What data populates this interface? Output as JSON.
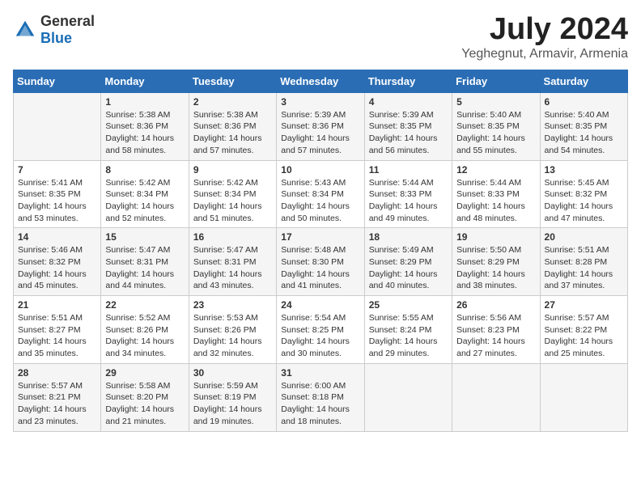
{
  "logo": {
    "general": "General",
    "blue": "Blue"
  },
  "title": {
    "month_year": "July 2024",
    "location": "Yeghegnut, Armavir, Armenia"
  },
  "weekdays": [
    "Sunday",
    "Monday",
    "Tuesday",
    "Wednesday",
    "Thursday",
    "Friday",
    "Saturday"
  ],
  "weeks": [
    [
      {
        "day": "",
        "sunrise": "",
        "sunset": "",
        "daylight": ""
      },
      {
        "day": "1",
        "sunrise": "Sunrise: 5:38 AM",
        "sunset": "Sunset: 8:36 PM",
        "daylight": "Daylight: 14 hours and 58 minutes."
      },
      {
        "day": "2",
        "sunrise": "Sunrise: 5:38 AM",
        "sunset": "Sunset: 8:36 PM",
        "daylight": "Daylight: 14 hours and 57 minutes."
      },
      {
        "day": "3",
        "sunrise": "Sunrise: 5:39 AM",
        "sunset": "Sunset: 8:36 PM",
        "daylight": "Daylight: 14 hours and 57 minutes."
      },
      {
        "day": "4",
        "sunrise": "Sunrise: 5:39 AM",
        "sunset": "Sunset: 8:35 PM",
        "daylight": "Daylight: 14 hours and 56 minutes."
      },
      {
        "day": "5",
        "sunrise": "Sunrise: 5:40 AM",
        "sunset": "Sunset: 8:35 PM",
        "daylight": "Daylight: 14 hours and 55 minutes."
      },
      {
        "day": "6",
        "sunrise": "Sunrise: 5:40 AM",
        "sunset": "Sunset: 8:35 PM",
        "daylight": "Daylight: 14 hours and 54 minutes."
      }
    ],
    [
      {
        "day": "7",
        "sunrise": "Sunrise: 5:41 AM",
        "sunset": "Sunset: 8:35 PM",
        "daylight": "Daylight: 14 hours and 53 minutes."
      },
      {
        "day": "8",
        "sunrise": "Sunrise: 5:42 AM",
        "sunset": "Sunset: 8:34 PM",
        "daylight": "Daylight: 14 hours and 52 minutes."
      },
      {
        "day": "9",
        "sunrise": "Sunrise: 5:42 AM",
        "sunset": "Sunset: 8:34 PM",
        "daylight": "Daylight: 14 hours and 51 minutes."
      },
      {
        "day": "10",
        "sunrise": "Sunrise: 5:43 AM",
        "sunset": "Sunset: 8:34 PM",
        "daylight": "Daylight: 14 hours and 50 minutes."
      },
      {
        "day": "11",
        "sunrise": "Sunrise: 5:44 AM",
        "sunset": "Sunset: 8:33 PM",
        "daylight": "Daylight: 14 hours and 49 minutes."
      },
      {
        "day": "12",
        "sunrise": "Sunrise: 5:44 AM",
        "sunset": "Sunset: 8:33 PM",
        "daylight": "Daylight: 14 hours and 48 minutes."
      },
      {
        "day": "13",
        "sunrise": "Sunrise: 5:45 AM",
        "sunset": "Sunset: 8:32 PM",
        "daylight": "Daylight: 14 hours and 47 minutes."
      }
    ],
    [
      {
        "day": "14",
        "sunrise": "Sunrise: 5:46 AM",
        "sunset": "Sunset: 8:32 PM",
        "daylight": "Daylight: 14 hours and 45 minutes."
      },
      {
        "day": "15",
        "sunrise": "Sunrise: 5:47 AM",
        "sunset": "Sunset: 8:31 PM",
        "daylight": "Daylight: 14 hours and 44 minutes."
      },
      {
        "day": "16",
        "sunrise": "Sunrise: 5:47 AM",
        "sunset": "Sunset: 8:31 PM",
        "daylight": "Daylight: 14 hours and 43 minutes."
      },
      {
        "day": "17",
        "sunrise": "Sunrise: 5:48 AM",
        "sunset": "Sunset: 8:30 PM",
        "daylight": "Daylight: 14 hours and 41 minutes."
      },
      {
        "day": "18",
        "sunrise": "Sunrise: 5:49 AM",
        "sunset": "Sunset: 8:29 PM",
        "daylight": "Daylight: 14 hours and 40 minutes."
      },
      {
        "day": "19",
        "sunrise": "Sunrise: 5:50 AM",
        "sunset": "Sunset: 8:29 PM",
        "daylight": "Daylight: 14 hours and 38 minutes."
      },
      {
        "day": "20",
        "sunrise": "Sunrise: 5:51 AM",
        "sunset": "Sunset: 8:28 PM",
        "daylight": "Daylight: 14 hours and 37 minutes."
      }
    ],
    [
      {
        "day": "21",
        "sunrise": "Sunrise: 5:51 AM",
        "sunset": "Sunset: 8:27 PM",
        "daylight": "Daylight: 14 hours and 35 minutes."
      },
      {
        "day": "22",
        "sunrise": "Sunrise: 5:52 AM",
        "sunset": "Sunset: 8:26 PM",
        "daylight": "Daylight: 14 hours and 34 minutes."
      },
      {
        "day": "23",
        "sunrise": "Sunrise: 5:53 AM",
        "sunset": "Sunset: 8:26 PM",
        "daylight": "Daylight: 14 hours and 32 minutes."
      },
      {
        "day": "24",
        "sunrise": "Sunrise: 5:54 AM",
        "sunset": "Sunset: 8:25 PM",
        "daylight": "Daylight: 14 hours and 30 minutes."
      },
      {
        "day": "25",
        "sunrise": "Sunrise: 5:55 AM",
        "sunset": "Sunset: 8:24 PM",
        "daylight": "Daylight: 14 hours and 29 minutes."
      },
      {
        "day": "26",
        "sunrise": "Sunrise: 5:56 AM",
        "sunset": "Sunset: 8:23 PM",
        "daylight": "Daylight: 14 hours and 27 minutes."
      },
      {
        "day": "27",
        "sunrise": "Sunrise: 5:57 AM",
        "sunset": "Sunset: 8:22 PM",
        "daylight": "Daylight: 14 hours and 25 minutes."
      }
    ],
    [
      {
        "day": "28",
        "sunrise": "Sunrise: 5:57 AM",
        "sunset": "Sunset: 8:21 PM",
        "daylight": "Daylight: 14 hours and 23 minutes."
      },
      {
        "day": "29",
        "sunrise": "Sunrise: 5:58 AM",
        "sunset": "Sunset: 8:20 PM",
        "daylight": "Daylight: 14 hours and 21 minutes."
      },
      {
        "day": "30",
        "sunrise": "Sunrise: 5:59 AM",
        "sunset": "Sunset: 8:19 PM",
        "daylight": "Daylight: 14 hours and 19 minutes."
      },
      {
        "day": "31",
        "sunrise": "Sunrise: 6:00 AM",
        "sunset": "Sunset: 8:18 PM",
        "daylight": "Daylight: 14 hours and 18 minutes."
      },
      {
        "day": "",
        "sunrise": "",
        "sunset": "",
        "daylight": ""
      },
      {
        "day": "",
        "sunrise": "",
        "sunset": "",
        "daylight": ""
      },
      {
        "day": "",
        "sunrise": "",
        "sunset": "",
        "daylight": ""
      }
    ]
  ]
}
